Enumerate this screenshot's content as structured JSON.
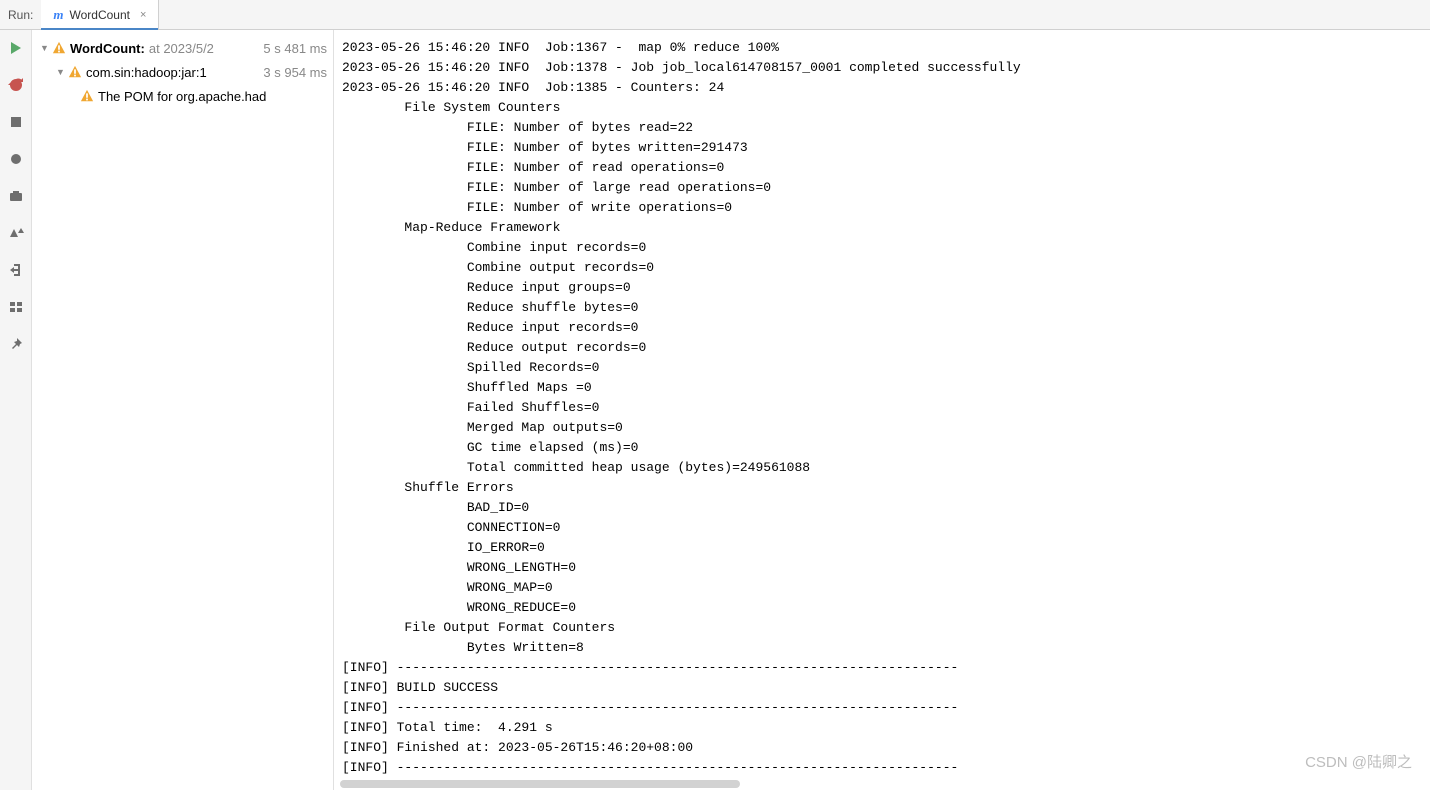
{
  "header": {
    "run_label": "Run:",
    "tab_icon": "m",
    "tab_name": "WordCount",
    "tab_close": "×"
  },
  "tree": {
    "root": {
      "name": "WordCount:",
      "meta": "at 2023/5/2",
      "time": "5 s 481 ms"
    },
    "child1": {
      "name": "com.sin:hadoop:jar:1",
      "time": "3 s 954 ms"
    },
    "child2": {
      "name": "The POM for org.apache.had"
    }
  },
  "console_lines": [
    "2023-05-26 15:46:20 INFO  Job:1367 -  map 0% reduce 100%",
    "2023-05-26 15:46:20 INFO  Job:1378 - Job job_local614708157_0001 completed successfully",
    "2023-05-26 15:46:20 INFO  Job:1385 - Counters: 24",
    "        File System Counters",
    "                FILE: Number of bytes read=22",
    "                FILE: Number of bytes written=291473",
    "                FILE: Number of read operations=0",
    "                FILE: Number of large read operations=0",
    "                FILE: Number of write operations=0",
    "        Map-Reduce Framework",
    "                Combine input records=0",
    "                Combine output records=0",
    "                Reduce input groups=0",
    "                Reduce shuffle bytes=0",
    "                Reduce input records=0",
    "                Reduce output records=0",
    "                Spilled Records=0",
    "                Shuffled Maps =0",
    "                Failed Shuffles=0",
    "                Merged Map outputs=0",
    "                GC time elapsed (ms)=0",
    "                Total committed heap usage (bytes)=249561088",
    "        Shuffle Errors",
    "                BAD_ID=0",
    "                CONNECTION=0",
    "                IO_ERROR=0",
    "                WRONG_LENGTH=0",
    "                WRONG_MAP=0",
    "                WRONG_REDUCE=0",
    "        File Output Format Counters",
    "                Bytes Written=8",
    "[INFO] ------------------------------------------------------------------------",
    "[INFO] BUILD SUCCESS",
    "[INFO] ------------------------------------------------------------------------",
    "[INFO] Total time:  4.291 s",
    "[INFO] Finished at: 2023-05-26T15:46:20+08:00",
    "[INFO] ------------------------------------------------------------------------"
  ],
  "watermark": "CSDN @陆卿之"
}
